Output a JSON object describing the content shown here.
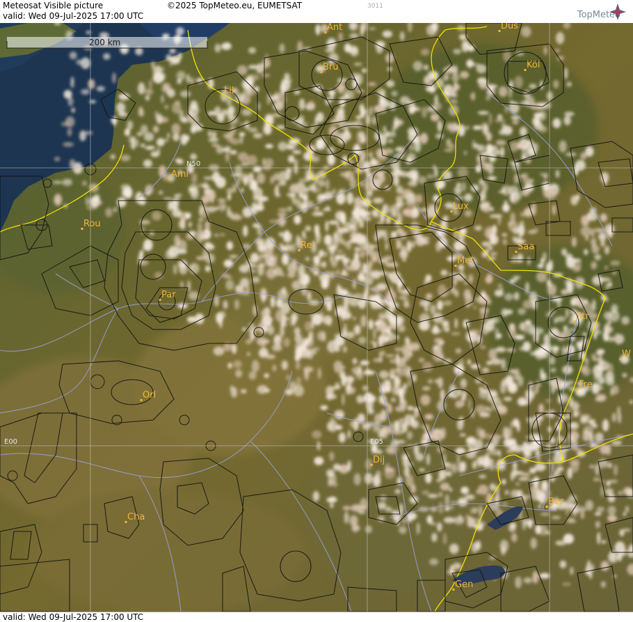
{
  "header": {
    "title": "Meteosat Visible picture",
    "valid": "valid:  Wed  09-Jul-2025  17:00 UTC",
    "copyright": "©2025 TopMeteo.eu, EUMETSAT",
    "code": "3011",
    "logo_text": "TopMeteo"
  },
  "footer": {
    "valid": "valid:  Wed  09-Jul-2025  17:00 UTC"
  },
  "scale": {
    "label": "200 km"
  },
  "grid": {
    "n50": "N50",
    "e00": "E00",
    "e05": "E05"
  },
  "cities": [
    {
      "label": "Ant"
    },
    {
      "label": "Düs"
    },
    {
      "label": "Bru"
    },
    {
      "label": "Köl"
    },
    {
      "label": "Lil"
    },
    {
      "label": "Ami"
    },
    {
      "label": "Lux"
    },
    {
      "label": "Rou"
    },
    {
      "label": "Rei"
    },
    {
      "label": "Saa"
    },
    {
      "label": "Met"
    },
    {
      "label": "Par"
    },
    {
      "label": "Str"
    },
    {
      "label": "W"
    },
    {
      "label": "Fre"
    },
    {
      "label": "Orl"
    },
    {
      "label": "Dij"
    },
    {
      "label": "Ber"
    },
    {
      "label": "Cha"
    },
    {
      "label": "Gen"
    }
  ],
  "colors": {
    "land_dark": "#4f5a2a",
    "land_light": "#8a7a45",
    "sea": "#1d3550",
    "cloud": "#f0e6dc",
    "border": "#f2e100",
    "river": "#9aa0d8",
    "airspace": "#111111",
    "city": "#f2b63a"
  }
}
